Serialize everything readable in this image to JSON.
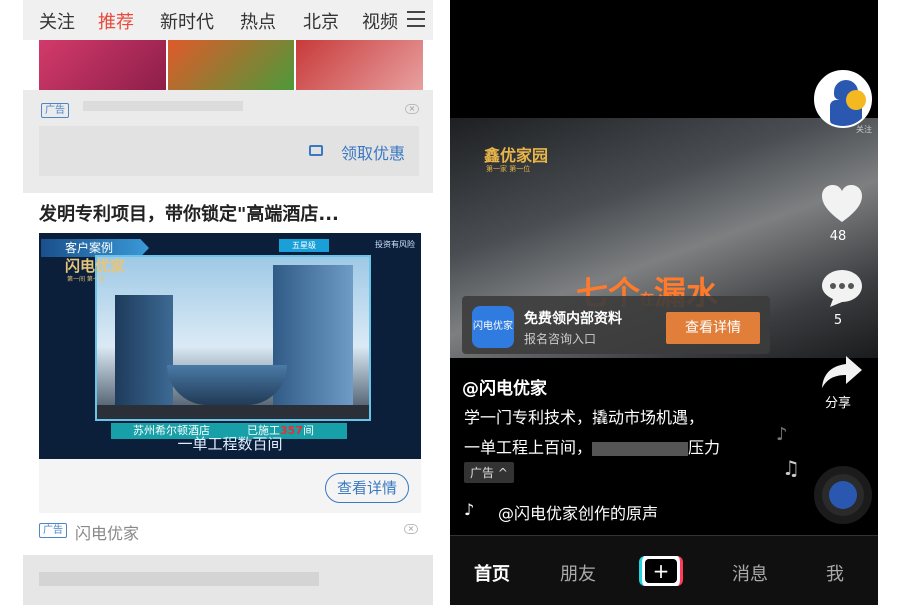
{
  "left": {
    "tabs": [
      "关注",
      "推荐",
      "新时代",
      "热点",
      "北京",
      "视频"
    ],
    "active_tab": "推荐",
    "ad_tag": "广告",
    "coupon_label": "领取优惠",
    "headline": "发明专利项目，带你锁定\"高端酒店...",
    "ad_image": {
      "case_label": "客户案例",
      "star_label": "五星级",
      "invest_label": "投资有风险",
      "logo": "闪电优家",
      "logo_sub": "第一间 第一家",
      "hotel_name": "苏州希尔顿酒店",
      "built_prefix": "已施工",
      "built_count": "357",
      "built_suffix": "间",
      "subtitle": "一单工程数百间"
    },
    "detail_button": "查看详情",
    "advertiser": "闪电优家"
  },
  "right": {
    "video": {
      "logo": "鑫优家园",
      "logo_sub": "第一家 第一位",
      "title_main_a": "七个",
      "title_small": "在",
      "title_main_b": "漏水"
    },
    "ad_card": {
      "app_icon_text": "闪电优家",
      "title": "免费领内部资料",
      "subtitle": "报名咨询入口",
      "button": "查看详情"
    },
    "follow_text": "关注",
    "like_count": "48",
    "comment_count": "5",
    "share_label": "分享",
    "author": "@闪电优家",
    "desc_line1": "学一门专利技术，撬动市场机遇，",
    "desc_line2_a": "一单工程上百间，",
    "desc_line2_b": "压力",
    "ad_tag": "广告 ^",
    "music": "@闪电优家创作的原声",
    "nav": [
      "首页",
      "朋友",
      "消息",
      "我"
    ],
    "active_nav": "首页",
    "plus_label": "+"
  },
  "colors": {
    "accent_red": "#e84a3c",
    "link_blue": "#3a78c2",
    "ad_orange": "#e17f3a"
  }
}
